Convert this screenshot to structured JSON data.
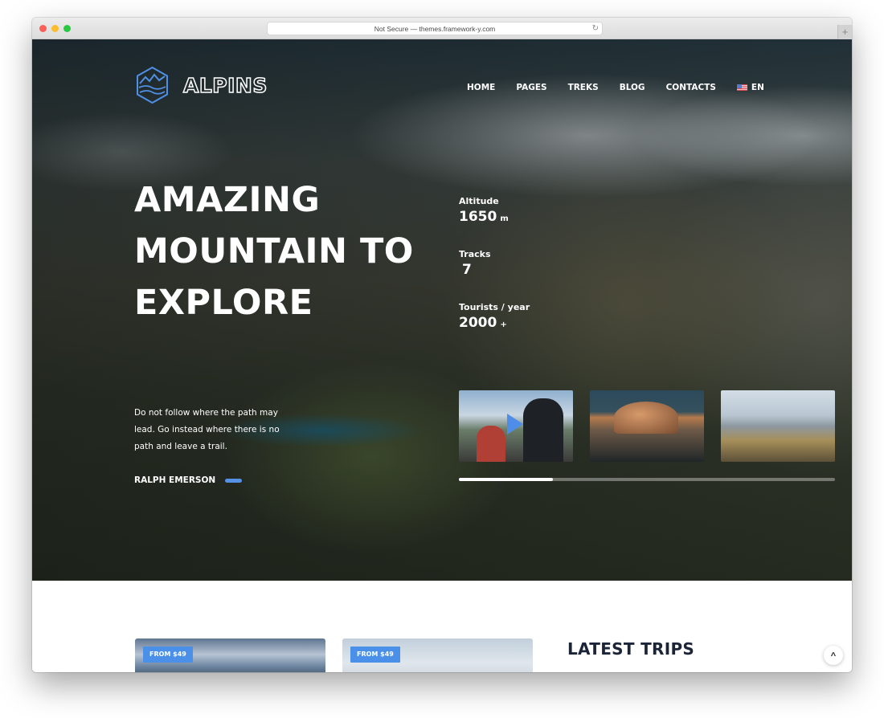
{
  "browser": {
    "address": "Not Secure — themes.framework-y.com",
    "reload_icon": "↻",
    "new_tab_icon": "+"
  },
  "site": {
    "logo_text": "ALPINS",
    "nav": [
      {
        "label": "HOME"
      },
      {
        "label": "PAGES"
      },
      {
        "label": "TREKS"
      },
      {
        "label": "BLOG"
      },
      {
        "label": "CONTACTS"
      }
    ],
    "language": "EN"
  },
  "hero": {
    "headline_lines": [
      "AMAZING",
      "MOUNTAIN TO",
      "EXPLORE"
    ],
    "stats": [
      {
        "label": "Altitude",
        "value": "1650",
        "unit": "m"
      },
      {
        "label": "Tracks",
        "value": "7",
        "unit": ""
      },
      {
        "label": "Tourists / year",
        "value": "2000",
        "unit": "+"
      }
    ],
    "quote": "Do not follow where the path may lead. Go instead where there is no path and leave a trail.",
    "author": "RALPH EMERSON",
    "gallery_progress": 0.25,
    "accent_color": "#4a90e8"
  },
  "latest": {
    "cards": [
      {
        "price": "FROM $49"
      },
      {
        "price": "FROM $49"
      }
    ],
    "title": "LATEST TRIPS",
    "scroll_top_icon": "^"
  }
}
